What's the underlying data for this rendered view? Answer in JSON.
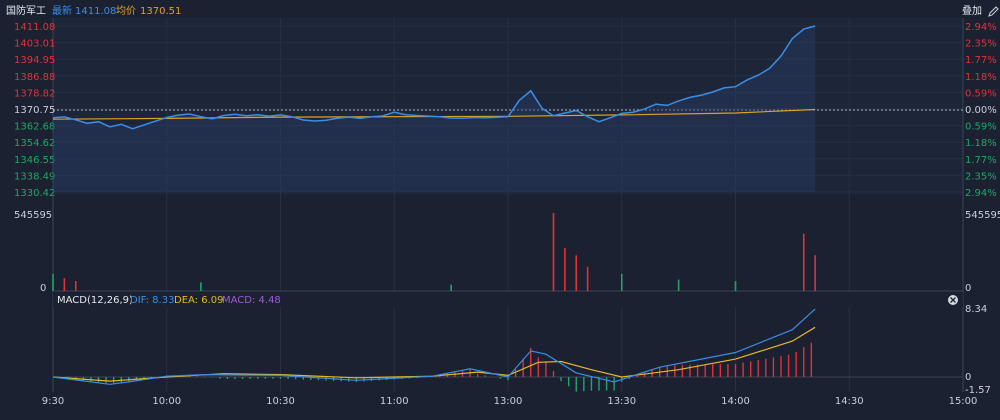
{
  "header": {
    "title": "国防军工",
    "latest_label": "最新",
    "latest_value": "1411.08",
    "avg_label": "均价",
    "avg_value": "1370.51",
    "overlay_button": "叠加",
    "edit_icon": "pencil-icon"
  },
  "colors": {
    "background": "#1b2130",
    "up": "#e0323a",
    "down": "#1ea66a",
    "price_line": "#3a8ee6",
    "avg_line": "#e0a020",
    "dif": "#3a8ee6",
    "dea": "#e5b821",
    "macd_label": "#a05ad8",
    "axis_text": "#c8cfdb"
  },
  "price_axis": {
    "left_labels": [
      "1411.08",
      "1403.01",
      "1394.95",
      "1386.88",
      "1378.82",
      "1370.75",
      "1362.68",
      "1354.62",
      "1346.55",
      "1338.49",
      "1330.42"
    ],
    "right_labels": [
      "2.94%",
      "2.35%",
      "1.77%",
      "1.18%",
      "0.59%",
      "0.00%",
      "0.59%",
      "1.18%",
      "1.77%",
      "2.35%",
      "2.94%"
    ],
    "base": 1370.75,
    "ylim": [
      1330.42,
      1411.08
    ]
  },
  "volume_axis": {
    "max_label": "545595",
    "zero_label": "0",
    "max": 545595
  },
  "macd": {
    "title": "MACD(12,26,9)",
    "dif_label": "DIF: 8.33",
    "dea_label": "DEA: 6.09",
    "macd_label": "MACD: 4.48",
    "max_label": "8.34",
    "zero_label": "0",
    "min_label": "-1.57",
    "ylim": [
      -1.57,
      8.34
    ],
    "close_icon": "close-icon"
  },
  "time_axis": [
    "9:30",
    "10:00",
    "10:30",
    "11:00",
    "13:00",
    "13:30",
    "14:00",
    "14:30",
    "15:00"
  ],
  "chart_data": {
    "type": "line",
    "x_range_minutes": [
      0,
      240
    ],
    "price": [
      [
        0,
        1366.5
      ],
      [
        3,
        1366.9
      ],
      [
        6,
        1365.5
      ],
      [
        9,
        1363.8
      ],
      [
        12,
        1364.6
      ],
      [
        15,
        1362.1
      ],
      [
        18,
        1363.3
      ],
      [
        21,
        1361.2
      ],
      [
        24,
        1363.0
      ],
      [
        27,
        1364.8
      ],
      [
        30,
        1366.6
      ],
      [
        33,
        1367.8
      ],
      [
        36,
        1368.3
      ],
      [
        39,
        1367.0
      ],
      [
        42,
        1366.0
      ],
      [
        45,
        1367.6
      ],
      [
        48,
        1368.2
      ],
      [
        51,
        1367.5
      ],
      [
        54,
        1368.0
      ],
      [
        57,
        1367.3
      ],
      [
        60,
        1367.9
      ],
      [
        63,
        1367.0
      ],
      [
        66,
        1365.4
      ],
      [
        69,
        1364.9
      ],
      [
        72,
        1365.3
      ],
      [
        75,
        1366.3
      ],
      [
        78,
        1366.8
      ],
      [
        81,
        1366.2
      ],
      [
        84,
        1367.0
      ],
      [
        87,
        1367.4
      ],
      [
        90,
        1369.2
      ],
      [
        93,
        1368.0
      ],
      [
        96,
        1367.6
      ],
      [
        99,
        1367.3
      ],
      [
        102,
        1367.0
      ],
      [
        105,
        1366.4
      ],
      [
        108,
        1366.3
      ],
      [
        111,
        1366.6
      ],
      [
        114,
        1366.5
      ],
      [
        117,
        1366.7
      ],
      [
        120,
        1367.0
      ],
      [
        123,
        1375.0
      ],
      [
        126,
        1379.6
      ],
      [
        129,
        1371.0
      ],
      [
        132,
        1367.5
      ],
      [
        135,
        1368.8
      ],
      [
        138,
        1370.0
      ],
      [
        141,
        1367.0
      ],
      [
        144,
        1364.6
      ],
      [
        147,
        1366.5
      ],
      [
        150,
        1368.6
      ],
      [
        153,
        1369.2
      ],
      [
        156,
        1370.7
      ],
      [
        159,
        1373.1
      ],
      [
        162,
        1372.5
      ],
      [
        165,
        1374.7
      ],
      [
        168,
        1376.4
      ],
      [
        171,
        1377.5
      ],
      [
        174,
        1379.0
      ],
      [
        177,
        1381.0
      ],
      [
        180,
        1381.6
      ],
      [
        183,
        1384.8
      ],
      [
        186,
        1387.2
      ],
      [
        189,
        1390.5
      ],
      [
        192,
        1396.5
      ],
      [
        195,
        1405.0
      ],
      [
        198,
        1409.6
      ],
      [
        201,
        1411.08
      ]
    ],
    "avg": [
      [
        0,
        1365.8
      ],
      [
        30,
        1366.2
      ],
      [
        60,
        1366.8
      ],
      [
        90,
        1367.0
      ],
      [
        120,
        1367.2
      ],
      [
        150,
        1367.9
      ],
      [
        180,
        1368.8
      ],
      [
        201,
        1370.51
      ]
    ],
    "volume_up": [
      [
        3,
        90000
      ],
      [
        6,
        70000
      ],
      [
        132,
        545595
      ],
      [
        135,
        300000
      ],
      [
        138,
        250000
      ],
      [
        141,
        170000
      ],
      [
        198,
        400000
      ],
      [
        201,
        250000
      ]
    ],
    "volume_down": [
      [
        0,
        120000
      ],
      [
        39,
        60000
      ],
      [
        105,
        45000
      ],
      [
        150,
        120000
      ],
      [
        165,
        80000
      ],
      [
        180,
        70000
      ]
    ],
    "dif": [
      [
        0,
        0
      ],
      [
        15,
        -0.9
      ],
      [
        20,
        -0.6
      ],
      [
        30,
        0.1
      ],
      [
        40,
        0.3
      ],
      [
        60,
        0.2
      ],
      [
        80,
        -0.4
      ],
      [
        100,
        0.1
      ],
      [
        110,
        1.0
      ],
      [
        120,
        0.0
      ],
      [
        126,
        3.2
      ],
      [
        130,
        2.8
      ],
      [
        138,
        0.5
      ],
      [
        148,
        -0.6
      ],
      [
        160,
        1.2
      ],
      [
        180,
        3.0
      ],
      [
        195,
        5.8
      ],
      [
        201,
        8.33
      ]
    ],
    "dea": [
      [
        0,
        0
      ],
      [
        15,
        -0.5
      ],
      [
        30,
        0.0
      ],
      [
        45,
        0.4
      ],
      [
        60,
        0.3
      ],
      [
        80,
        -0.1
      ],
      [
        100,
        0.1
      ],
      [
        112,
        0.6
      ],
      [
        120,
        0.2
      ],
      [
        128,
        1.8
      ],
      [
        134,
        1.9
      ],
      [
        142,
        0.9
      ],
      [
        150,
        0.0
      ],
      [
        165,
        0.9
      ],
      [
        180,
        2.2
      ],
      [
        195,
        4.4
      ],
      [
        201,
        6.09
      ]
    ],
    "xlabel": "",
    "ylabel": ""
  }
}
